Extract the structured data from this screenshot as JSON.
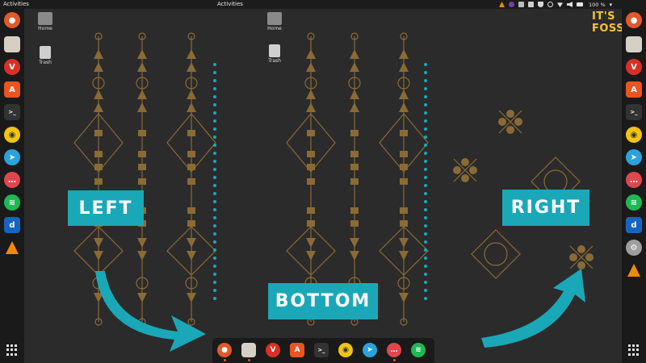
{
  "topbar": {
    "activities_left": "Activities",
    "activities_center": "Activities",
    "battery": "100 %"
  },
  "desktop_icons": [
    {
      "label": "Home"
    },
    {
      "label": "Trash"
    },
    {
      "label": "Home"
    },
    {
      "label": "Trash"
    }
  ],
  "callouts": {
    "left": "LEFT",
    "bottom": "BOTTOM",
    "right": "RIGHT"
  },
  "logo": {
    "text": "IT'S FOSS"
  },
  "colors": {
    "panel": "#1c1c1c",
    "dock": "#1a1a1a",
    "wallpaper": "#2b2b2b",
    "ornament": "#8a6a35",
    "accent_teal": "#1aa8b8",
    "callout_text": "#ffffff",
    "logo": "#f6c431"
  },
  "left_dock": [
    "firefox-icon",
    "files-icon",
    "vivaldi-icon",
    "software-center-icon",
    "terminal-icon",
    "rhythmbox-icon",
    "telegram-icon",
    "rocketchat-icon",
    "spotify-icon",
    "dict-icon",
    "vlc-icon",
    "show-apps-icon"
  ],
  "right_dock": [
    "firefox-icon",
    "files-icon",
    "vivaldi-icon",
    "software-center-icon",
    "terminal-icon",
    "rhythmbox-icon",
    "telegram-icon",
    "rocketchat-icon",
    "spotify-icon",
    "dict-icon",
    "settings-icon",
    "vlc-icon",
    "show-apps-icon"
  ],
  "bottom_dock": [
    "firefox-icon",
    "files-icon",
    "vivaldi-icon",
    "software-center-icon",
    "terminal-icon",
    "rhythmbox-icon",
    "telegram-icon",
    "rocketchat-icon",
    "spotify-icon"
  ]
}
